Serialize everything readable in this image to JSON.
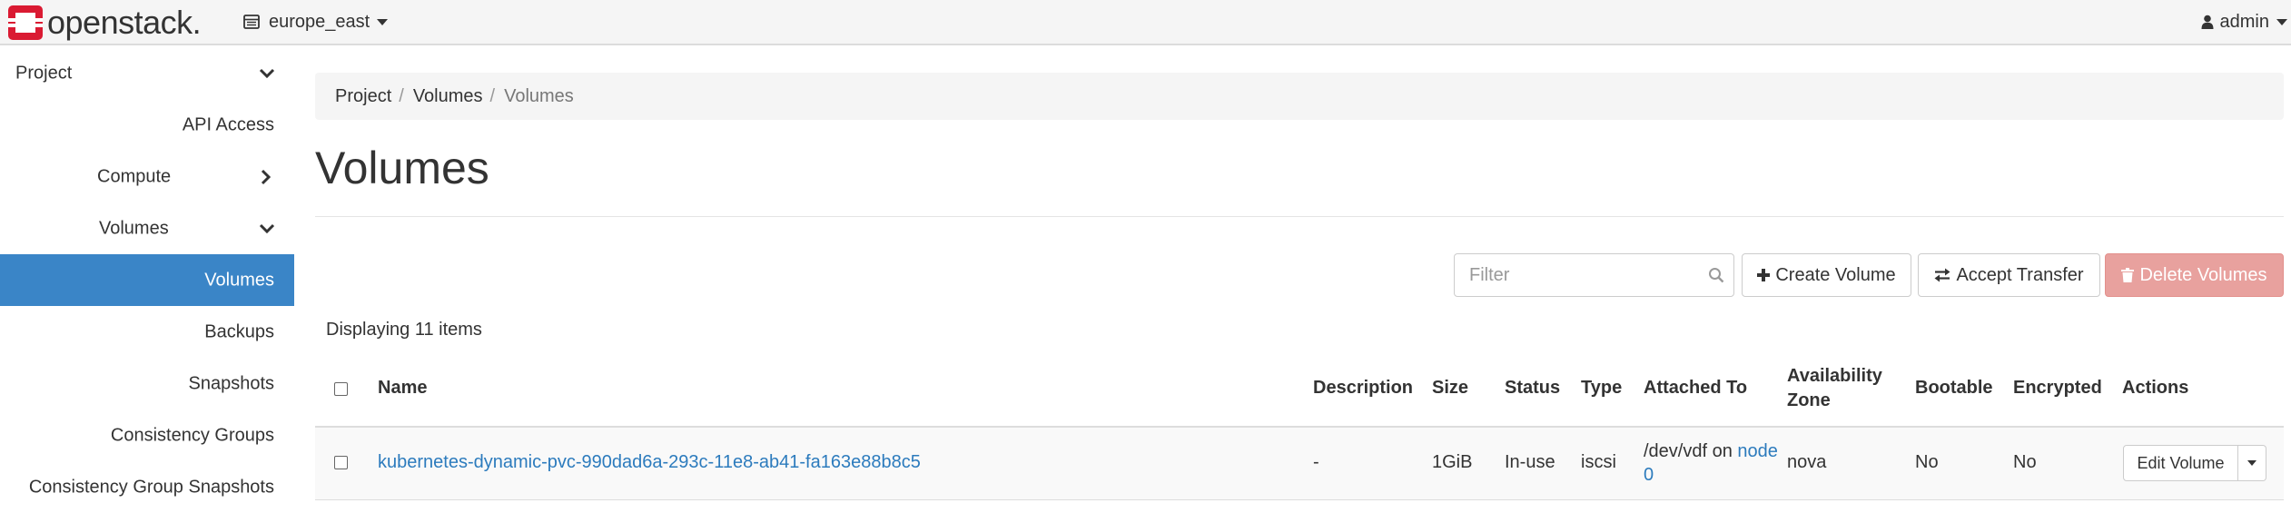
{
  "header": {
    "brand": "openstack.",
    "region": "europe_east",
    "user": "admin"
  },
  "sidebar": {
    "items": [
      {
        "label": "Project",
        "icon": "chevron-down-icon"
      },
      {
        "label": "API Access"
      },
      {
        "label": "Compute",
        "icon": "chevron-right-icon"
      },
      {
        "label": "Volumes",
        "icon": "chevron-down-icon"
      },
      {
        "label": "Volumes",
        "active": true
      },
      {
        "label": "Backups"
      },
      {
        "label": "Snapshots"
      },
      {
        "label": "Consistency Groups"
      },
      {
        "label": "Consistency Group Snapshots"
      }
    ]
  },
  "breadcrumb": [
    "Project",
    "Volumes",
    "Volumes"
  ],
  "page": {
    "title": "Volumes"
  },
  "toolbar": {
    "filter_placeholder": "Filter",
    "create_label": "Create Volume",
    "accept_label": "Accept Transfer",
    "delete_label": "Delete Volumes"
  },
  "table": {
    "count_text": "Displaying 11 items",
    "columns": {
      "name": "Name",
      "description": "Description",
      "size": "Size",
      "status": "Status",
      "type": "Type",
      "attached_to": "Attached To",
      "availability_zone_line1": "Availability",
      "availability_zone_line2": "Zone",
      "bootable": "Bootable",
      "encrypted": "Encrypted",
      "actions": "Actions"
    },
    "rows": [
      {
        "name": "kubernetes-dynamic-pvc-990dad6a-293c-11e8-ab41-fa163e88b8c5",
        "description": "-",
        "size": "1GiB",
        "status": "In-use",
        "type": "iscsi",
        "attached_device": "/dev/vdf on ",
        "attached_host": "node0",
        "availability_zone": "nova",
        "bootable": "No",
        "encrypted": "No",
        "action_label": "Edit Volume"
      }
    ]
  },
  "colors": {
    "accent": "#3a85c7",
    "danger": "#e8a19e",
    "link": "#2c7bbd",
    "brand_red": "#da1a32"
  }
}
